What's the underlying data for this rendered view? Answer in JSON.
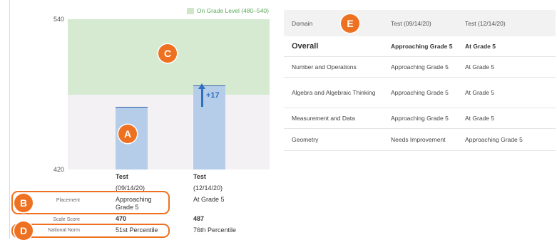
{
  "chart": {
    "y_max_label": "540",
    "y_min_label": "420",
    "legend_label": "On Grade Level (480–540)",
    "gain_label": "+17"
  },
  "chart_data": {
    "type": "bar",
    "categories": [
      "Test (09/14/20)",
      "Test (12/14/20)"
    ],
    "values": [
      470,
      487
    ],
    "ylim": [
      420,
      540
    ],
    "band": {
      "label": "On Grade Level (480–540)",
      "range": [
        480,
        540
      ],
      "color": "#d6ead2"
    },
    "bar_color": "#b6cdea",
    "gain": "+17",
    "legend_position": "top-right"
  },
  "columns": [
    {
      "heading": "Test",
      "date": "(09/14/20)"
    },
    {
      "heading": "Test",
      "date": "(12/14/20)"
    }
  ],
  "rows": {
    "placement": {
      "label": "Placement",
      "values": [
        "Approaching Grade 5",
        "At Grade 5"
      ]
    },
    "scale_score": {
      "label": "Scale Score",
      "values": [
        "470",
        "487"
      ]
    },
    "national_norm": {
      "label": "National Norm",
      "values": [
        "51st Percentile",
        "76th Percentile"
      ]
    }
  },
  "callouts": {
    "a": "A",
    "b": "B",
    "c": "C",
    "d": "D",
    "e": "E"
  },
  "table": {
    "headers": [
      "Domain",
      "Test (09/14/20)",
      "Test (12/14/20)"
    ],
    "rows": [
      {
        "domain": "Overall",
        "test1": "Approaching Grade 5",
        "test2": "At Grade 5"
      },
      {
        "domain": "Number and Operations",
        "test1": "Approaching Grade 5",
        "test2": "At Grade 5"
      },
      {
        "domain": "Algebra and Algebraic Thinking",
        "test1": "Approaching Grade 5",
        "test2": "At Grade 5"
      },
      {
        "domain": "Measurement and Data",
        "test1": "Approaching Grade 5",
        "test2": "At Grade 5"
      },
      {
        "domain": "Geometry",
        "test1": "Needs Improvement",
        "test2": "Approaching Grade 5"
      }
    ]
  },
  "colors": {
    "accent": "#ee7121",
    "bar": "#b6cdea",
    "band": "#d6ead2",
    "gain": "#2f6fbd"
  }
}
